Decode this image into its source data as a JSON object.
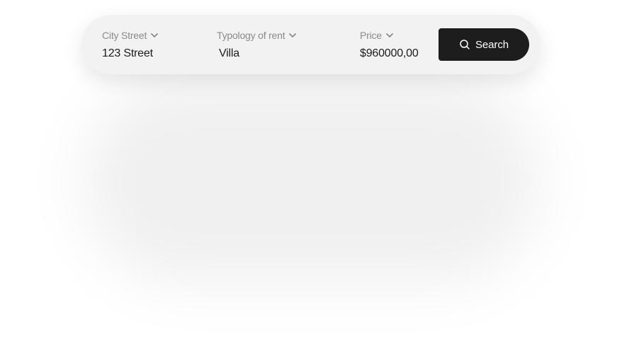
{
  "search_bar": {
    "fields": [
      {
        "label": "City Street",
        "value": "123 Street",
        "icon": "chevron-down-icon"
      },
      {
        "label": "Typology of rent",
        "value": "Villa",
        "icon": "chevron-down-icon"
      },
      {
        "label": "Price",
        "value": "$960000,00",
        "icon": "chevron-down-icon"
      }
    ],
    "button": {
      "label": "Search",
      "icon": "search-icon"
    }
  },
  "colors": {
    "bar_background": "#f2f2f2",
    "label": "#8a8a8a",
    "value": "#1c1c1c",
    "button_background": "#1d1d1d",
    "button_text": "#ffffff"
  }
}
